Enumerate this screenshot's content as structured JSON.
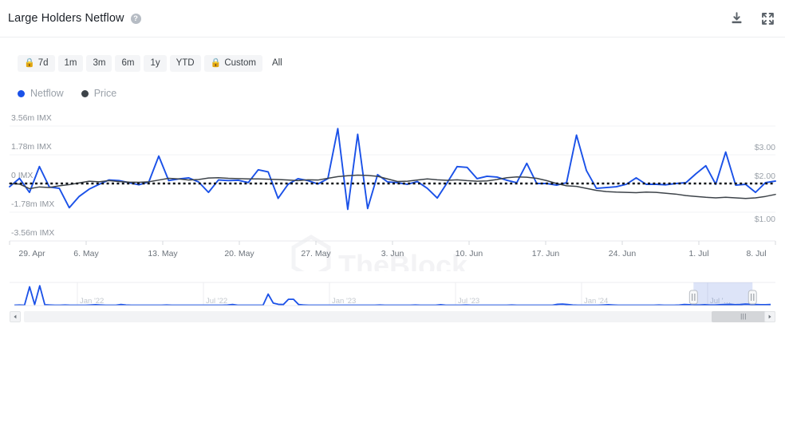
{
  "header": {
    "title": "Large Holders Netflow",
    "help_icon": "question-mark-circle-icon",
    "download_icon": "download-icon",
    "fullscreen_icon": "fullscreen-icon"
  },
  "ranges": [
    {
      "label": "7d",
      "locked": true,
      "active": true
    },
    {
      "label": "1m",
      "locked": false,
      "active": false
    },
    {
      "label": "3m",
      "locked": false,
      "active": false
    },
    {
      "label": "6m",
      "locked": false,
      "active": false
    },
    {
      "label": "1y",
      "locked": false,
      "active": false
    },
    {
      "label": "YTD",
      "locked": false,
      "active": false
    },
    {
      "label": "Custom",
      "locked": true,
      "active": false
    },
    {
      "label": "All",
      "locked": false,
      "active": false
    }
  ],
  "lock_glyph": "🔒",
  "legend": [
    {
      "label": "Netflow",
      "color": "#1a51e8"
    },
    {
      "label": "Price",
      "color": "#3d4349"
    }
  ],
  "watermark": "TheBlock",
  "navigator": {
    "ticks": [
      "Jan '22",
      "Jul '22",
      "Jan '23",
      "Jul '23",
      "Jan '24",
      "Jul '…"
    ],
    "selection_start_pct": 89.8,
    "selection_end_pct": 97.6,
    "handle_icon": "range-handle-icon"
  },
  "scrollbar": {
    "left_arrow_icon": "scroll-left-arrow-icon",
    "right_arrow_icon": "scroll-right-arrow-icon",
    "grip": "|||"
  },
  "chart_data": {
    "type": "line",
    "title": "Large Holders Netflow",
    "xlabel": "",
    "ylabel": "",
    "grid": true,
    "legend_position": "top-left",
    "x_ticks": [
      "29. Apr",
      "6. May",
      "13. May",
      "20. May",
      "27. May",
      "3. Jun",
      "10. Jun",
      "17. Jun",
      "24. Jun",
      "1. Jul",
      "8. Jul"
    ],
    "y_left": {
      "label": "Netflow",
      "ticks": [
        "-3.56m IMX",
        "-1.78m IMX",
        "0 IMX",
        "1.78m IMX",
        "3.56m IMX"
      ],
      "ylim": [
        -3560000,
        3560000
      ],
      "unit": "IMX"
    },
    "y_right": {
      "label": "Price",
      "ticks": [
        "$1.00",
        "$2.00",
        "$3.00"
      ],
      "ylim": [
        0.5,
        3.5
      ],
      "unit": "USD"
    },
    "zero_line": 0,
    "series": [
      {
        "name": "Netflow",
        "axis": "left",
        "color": "#1a51e8",
        "values": [
          -0.2,
          0.32,
          -0.55,
          1.05,
          -0.22,
          -0.3,
          -1.5,
          -0.8,
          -0.35,
          -0.05,
          0.22,
          0.18,
          0.05,
          -0.08,
          0.1,
          1.7,
          0.18,
          0.28,
          0.35,
          0.1,
          -0.55,
          0.22,
          0.18,
          0.2,
          0.06,
          0.85,
          0.72,
          -0.92,
          -0.05,
          0.3,
          0.18,
          -0.03,
          0.3,
          3.4,
          -1.6,
          3.05,
          -1.55,
          0.55,
          0.1,
          0.05,
          -0.05,
          0.12,
          -0.3,
          -0.9,
          0.05,
          1.05,
          1.0,
          0.3,
          0.45,
          0.4,
          0.2,
          0.05,
          1.25,
          0.0,
          0.0,
          -0.1,
          0.05,
          3.0,
          0.8,
          -0.3,
          -0.25,
          -0.2,
          -0.05,
          0.35,
          -0.05,
          -0.05,
          -0.08,
          0.0,
          0.05,
          0.6,
          1.1,
          -0.05,
          1.95,
          -0.1,
          -0.05,
          -0.55,
          0.05,
          0.15
        ]
      },
      {
        "name": "Price",
        "axis": "right",
        "color": "#3d4349",
        "values": [
          2.0,
          1.98,
          1.82,
          1.88,
          1.86,
          1.92,
          1.96,
          2.02,
          2.08,
          2.06,
          2.1,
          2.07,
          2.05,
          2.04,
          2.06,
          2.12,
          2.18,
          2.16,
          2.12,
          2.14,
          2.19,
          2.2,
          2.18,
          2.17,
          2.16,
          2.16,
          2.15,
          2.14,
          2.12,
          2.1,
          2.13,
          2.12,
          2.18,
          2.24,
          2.27,
          2.29,
          2.28,
          2.25,
          2.16,
          2.07,
          2.08,
          2.12,
          2.16,
          2.13,
          2.11,
          2.13,
          2.1,
          2.08,
          2.09,
          2.14,
          2.2,
          2.23,
          2.22,
          2.18,
          2.1,
          2.0,
          1.92,
          1.9,
          1.83,
          1.76,
          1.72,
          1.7,
          1.69,
          1.68,
          1.7,
          1.69,
          1.66,
          1.63,
          1.58,
          1.55,
          1.52,
          1.5,
          1.52,
          1.5,
          1.48,
          1.5,
          1.55,
          1.62
        ]
      }
    ],
    "navigator_series": {
      "name": "Netflow (full history)",
      "color": "#1a51e8",
      "values": [
        0.02,
        0.03,
        0.02,
        0.9,
        0.05,
        0.95,
        0.04,
        0.03,
        0.02,
        0.02,
        0.03,
        0.02,
        0.02,
        0.02,
        0.02,
        0.03,
        0.04,
        0.03,
        0.02,
        0.02,
        0.02,
        0.05,
        0.03,
        0.02,
        0.02,
        0.02,
        0.02,
        0.02,
        0.02,
        0.02,
        0.03,
        0.02,
        0.02,
        0.02,
        0.02,
        0.02,
        0.02,
        0.02,
        0.02,
        0.02,
        0.02,
        0.02,
        0.03,
        0.05,
        0.02,
        0.02,
        0.02,
        0.02,
        0.02,
        0.02,
        0.55,
        0.12,
        0.06,
        0.05,
        0.3,
        0.3,
        0.05,
        0.03,
        0.02,
        0.02,
        0.02,
        0.02,
        0.02,
        0.02,
        0.02,
        0.02,
        0.02,
        0.02,
        0.02,
        0.02,
        0.02,
        0.02,
        0.03,
        0.02,
        0.02,
        0.02,
        0.02,
        0.02,
        0.02,
        0.03,
        0.02,
        0.02,
        0.02,
        0.02,
        0.04,
        0.02,
        0.02,
        0.02,
        0.02,
        0.03,
        0.02,
        0.02,
        0.02,
        0.02,
        0.02,
        0.02,
        0.02,
        0.02,
        0.03,
        0.02,
        0.02,
        0.02,
        0.02,
        0.02,
        0.02,
        0.02,
        0.02,
        0.06,
        0.07,
        0.05,
        0.03,
        0.02,
        0.02,
        0.02,
        0.02,
        0.02,
        0.03,
        0.04,
        0.03,
        0.02,
        0.02,
        0.02,
        0.02,
        0.02,
        0.02,
        0.02,
        0.02,
        0.03,
        0.02,
        0.02,
        0.02,
        0.03,
        0.05,
        0.04,
        0.03,
        0.03,
        0.04,
        0.03,
        0.03,
        0.04,
        0.05,
        0.06,
        0.04,
        0.05,
        0.07,
        0.06,
        0.05,
        0.04,
        0.04,
        0.05
      ]
    }
  }
}
